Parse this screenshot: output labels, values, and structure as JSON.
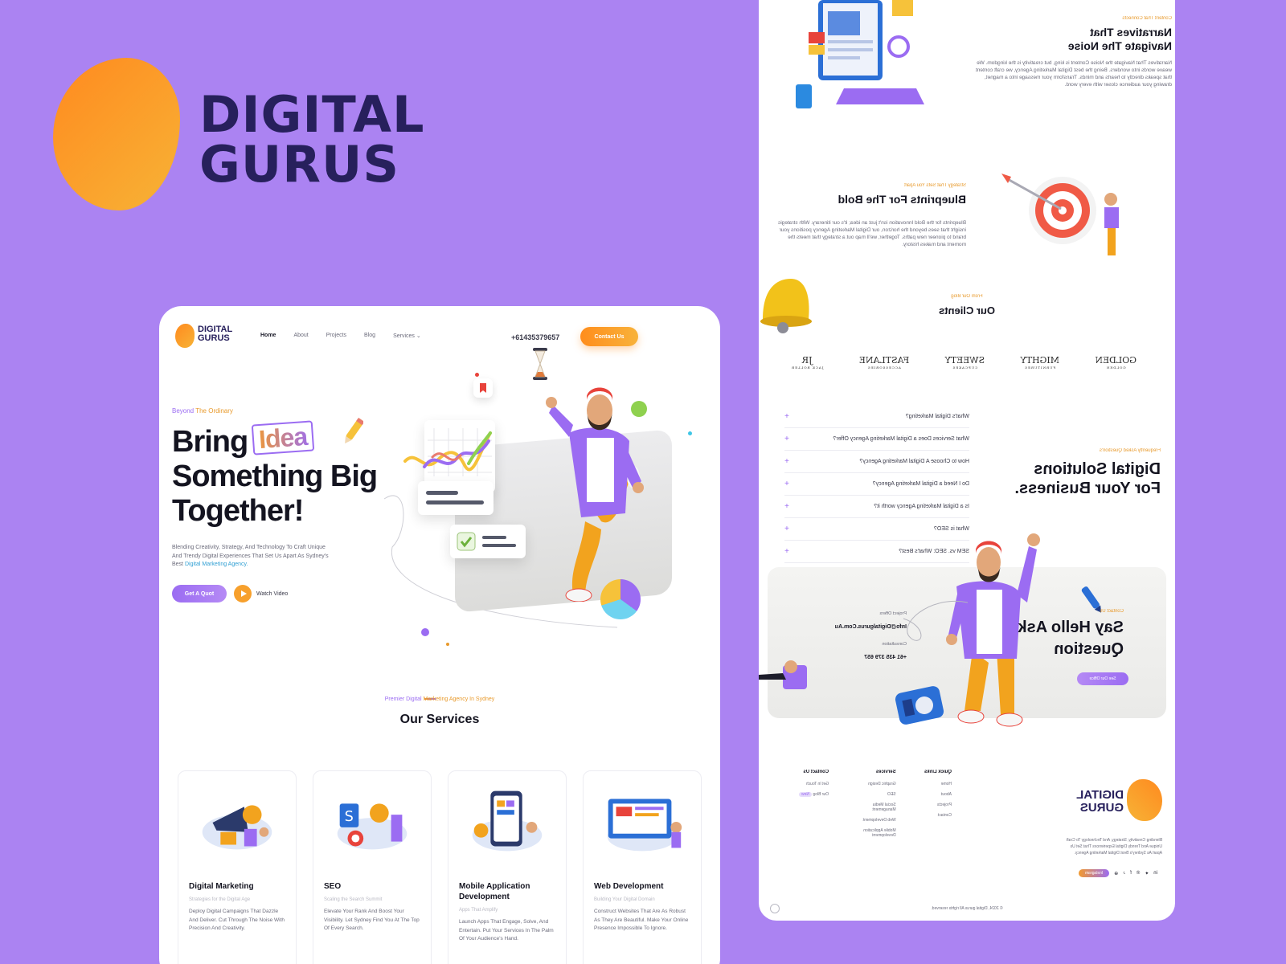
{
  "brand": {
    "line1": "DIGITAL",
    "line2": "GURUS"
  },
  "nav": {
    "logo_line1": "DIGITAL",
    "logo_line2": "GURUS",
    "links": [
      "Home",
      "About",
      "Projects",
      "Blog",
      "Services"
    ],
    "phone": "+61435379657",
    "contact_label": "Contact Us"
  },
  "hero": {
    "eyebrow_a": "Beyond",
    "eyebrow_b": " The Ordinary",
    "title_a": "Bring",
    "title_highlight": "Idea",
    "title_b": "Something Big Together!",
    "description": "Blending Creativity, Strategy, And Technology To Craft Unique And Trendy Digital Experiences That Set Us Apart As Sydney's Best",
    "description_link": "Digital Marketing Agency.",
    "quote_label": "Get A Quot",
    "watch_label": "Watch Video"
  },
  "services_section": {
    "eyebrow_a": "Premier Digital",
    "eyebrow_b": " Marketing Agency In Sydney",
    "title": "Our Services",
    "items": [
      {
        "name": "Digital Marketing",
        "subtitle": "Strategies for the Digital Age",
        "description": "Deploy Digital Campaigns That Dazzle And Deliver. Cut Through The Noise With Precision And Creativity."
      },
      {
        "name": "SEO",
        "subtitle": "Scaling the Search Summit",
        "description": "Elevate Your Rank And Boost Your Visibility. Let Sydney Find You At The Top Of Every Search."
      },
      {
        "name": "Mobile Application Development",
        "subtitle": "Apps That Amplify",
        "description": "Launch Apps That Engage, Solve, And Entertain. Put Your Services In The Palm Of Your Audience's Hand."
      },
      {
        "name": "Web Development",
        "subtitle": "Building Your Digital Domain",
        "description": "Construct Websites That Are As Robust As They Are Beautiful. Make Your Online Presence Impossible To Ignore."
      }
    ]
  },
  "right_page": {
    "content": {
      "eyebrow": "Content That Connects",
      "title": "Narratives That Navigate The Noise",
      "text": "Narratives That Navigate the Noise Content is king, but creativity is the kingdom. We weave words into wonders. Being the best Digital Marketing Agency, we craft content that speaks directly to hearts and minds. Transform your message into a magnet, drawing your audience closer with every word."
    },
    "strategy": {
      "eyebrow": "Strategy That Sets You Apart",
      "title": "Blueprints For The Bold",
      "text": "Blueprints for the Bold Innovation isn't just an idea; it's our itinerary. With strategic insight that sees beyond the horizon, our Digital Marketing Agency positions your brand to pioneer new paths. Together, we'll map out a strategy that meets the moment and makes history."
    },
    "clients": {
      "eyebrow": "From Our Blog",
      "title": "Our Clients",
      "logos": [
        {
          "name": "GOLDEN",
          "sub": "GOLDEN"
        },
        {
          "name": "MIGHTY",
          "sub": "FURNITURES"
        },
        {
          "name": "SWEETY",
          "sub": "CUPCAKES"
        },
        {
          "name": "FASTLANE",
          "sub": "ACCESSORIES"
        },
        {
          "name": "JR",
          "sub": "JACK ROLLER"
        }
      ]
    },
    "faq": {
      "eyebrow": "Frequently Asked Question's",
      "title": "Digital Solutions For Your Business.",
      "questions": [
        "What's Digital Marketing?",
        "What Services Does a Digital Marketing Agency Offer?",
        "How to Choose A Digital Marketing Agency?",
        "Do I Need a Digital Marketing Agency?",
        "Is a Digital Marketing Agency worth it?",
        "What is SEO?",
        "SEM vs. SEO: What's Best?"
      ]
    },
    "contact": {
      "eyebrow": "Contact Us",
      "title": "Say Hello Ask Question",
      "project_label": "Project Offers",
      "email": "Info@Digitalgurus.Com.Au",
      "consultation_label": "Consultation",
      "phone": "+61 435 379 657",
      "button": "See Our Office"
    },
    "footer": {
      "logo_line1": "DIGITAL",
      "logo_line2": "GURUS",
      "about": "Blending Creativity, Strategy, And Technology To Craft Unique And Trendy Digital Experiences That Set Us Apart As Sydney's Best Digital Marketing Agency.",
      "quick_links_title": "Quick Links",
      "quick_links": [
        "Home",
        "About",
        "Projects",
        "Contact"
      ],
      "services_title": "Services",
      "services": [
        "Graphic Design",
        "SEO",
        "Social Media Management",
        "Web Development",
        "Mobile Application Development"
      ],
      "contact_title": "Contact Us",
      "contact_items": [
        "Get In Touch",
        "Our Blog"
      ],
      "new_badge": "New",
      "instagram": "Instagram",
      "copyright": "© 2024, Digital gurus All rights reserved."
    }
  },
  "colors": {
    "background": "#ab83f2",
    "brand_dark": "#27205c",
    "orange": "#ff8d1c",
    "purple": "#9b6cf2"
  }
}
